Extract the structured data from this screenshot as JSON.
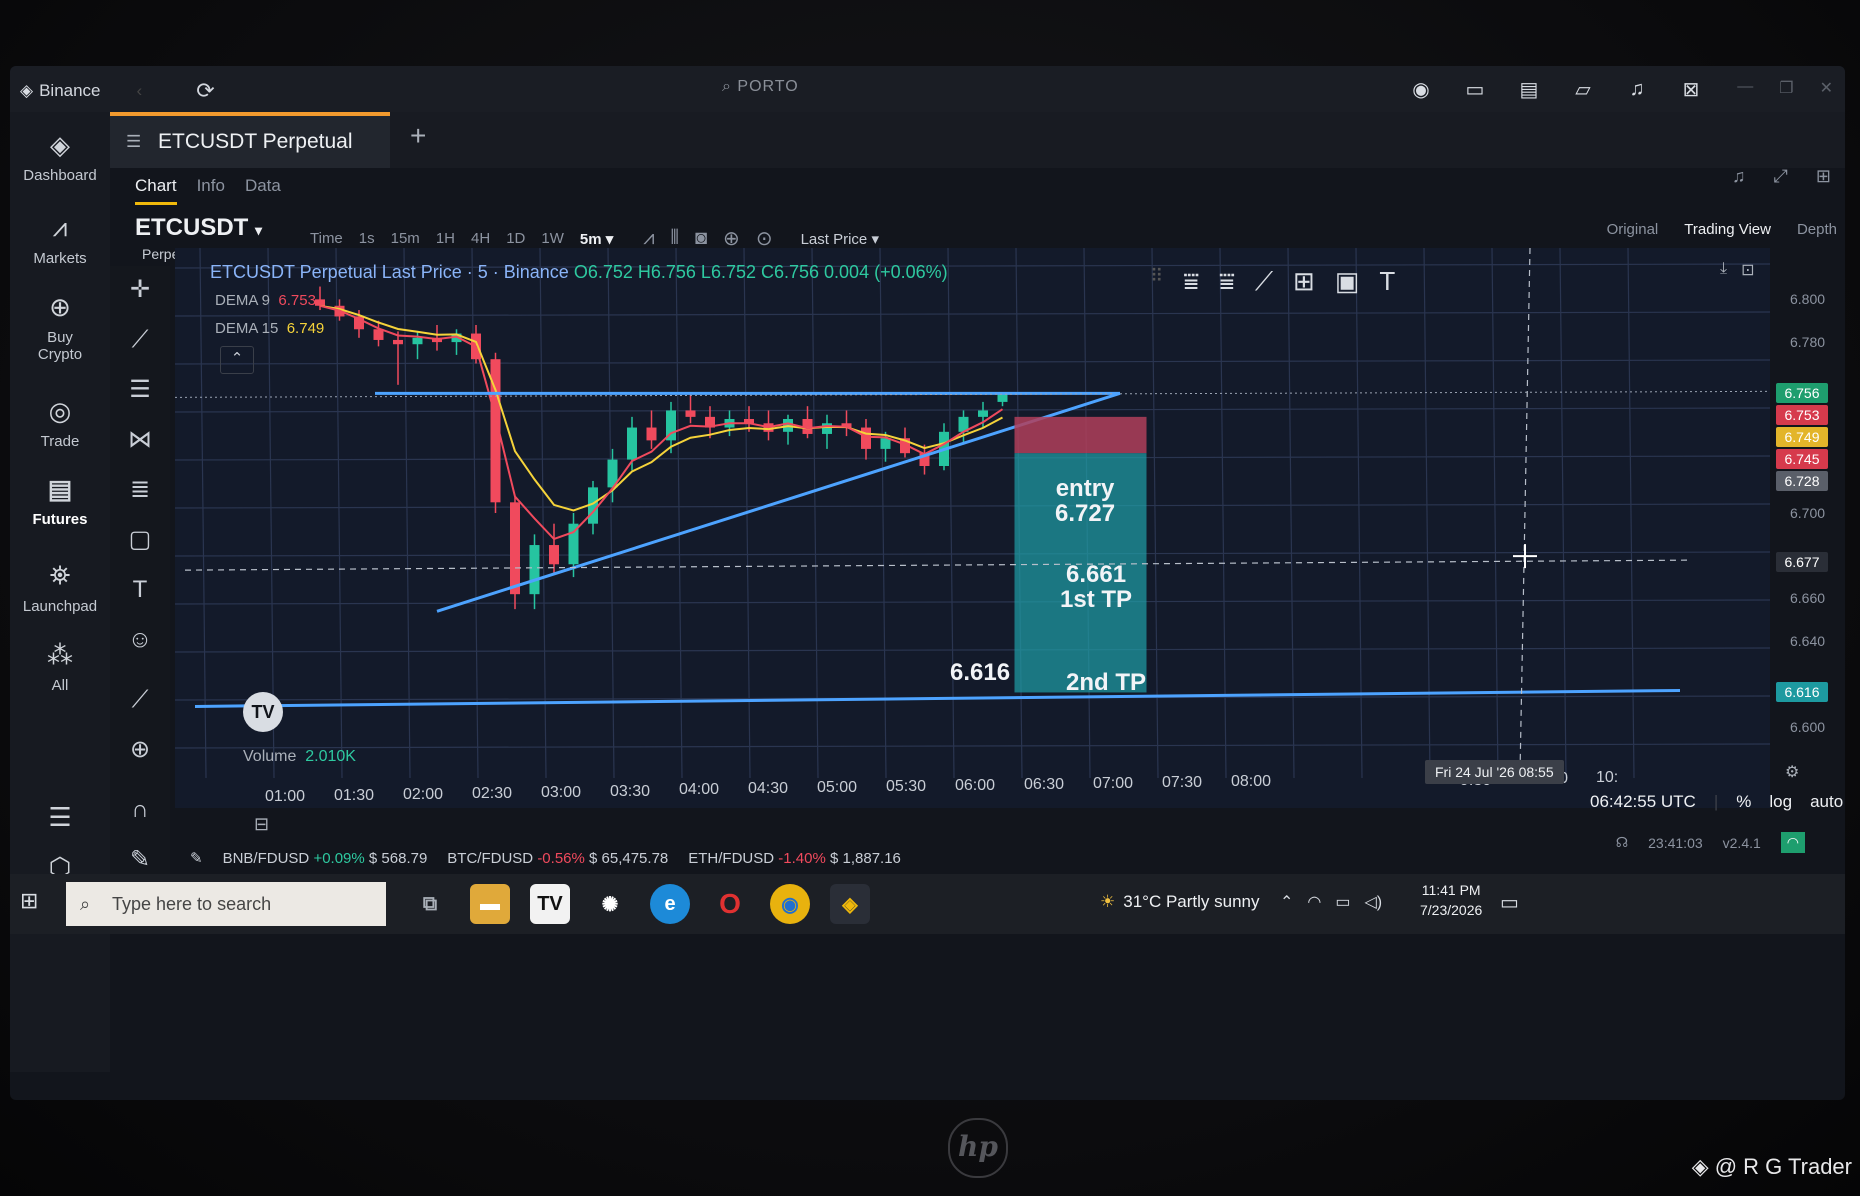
{
  "app": {
    "name": "Binance",
    "search_text": "PORTO"
  },
  "nav": [
    {
      "label": "Dashboard",
      "icon": "dashboard-icon"
    },
    {
      "label": "Markets",
      "icon": "markets-icon"
    },
    {
      "label": "Buy Crypto",
      "icon": "buy-crypto-icon"
    },
    {
      "label": "Trade",
      "icon": "trade-icon"
    },
    {
      "label": "Futures",
      "icon": "futures-icon"
    },
    {
      "label": "Launchpad",
      "icon": "launchpad-icon"
    },
    {
      "label": "All",
      "icon": "all-icon"
    }
  ],
  "tab": {
    "label": "ETCUSDT Perpetual"
  },
  "subtabs": [
    "Chart",
    "Info",
    "Data"
  ],
  "symbol": {
    "name": "ETCUSDT",
    "type": "Perpetual"
  },
  "intervals": [
    "Time",
    "1s",
    "15m",
    "1H",
    "4H",
    "1D",
    "1W",
    "5m"
  ],
  "selected_interval": "5m",
  "price_source": "Last Price",
  "view_modes": [
    "Original",
    "Trading View",
    "Depth"
  ],
  "selected_view": "Trading View",
  "legend": {
    "title": "ETCUSDT Perpetual Last Price · 5 · Binance",
    "ohlc": "O6.752  H6.756  L6.752  C6.756  0.004 (+0.06%)"
  },
  "indicators": [
    {
      "label": "DEMA 9",
      "value": "6.753"
    },
    {
      "label": "DEMA 15",
      "value": "6.749"
    }
  ],
  "annotations": {
    "entry_label": "entry",
    "entry_value": "6.727",
    "tp1_value": "6.661",
    "tp1_label": "1st TP",
    "tp2_value": "6.616",
    "tp2_label": "2nd TP"
  },
  "price_axis": [
    "6.800",
    "6.780",
    "6.700",
    "6.660",
    "6.640",
    "6.600"
  ],
  "price_tags": [
    {
      "value": "6.756",
      "color": "#1e9e6e"
    },
    {
      "value": "6.753",
      "color": "#d63a4c"
    },
    {
      "value": "6.749",
      "color": "#e3b52a"
    },
    {
      "value": "6.745",
      "color": "#d63a4c"
    },
    {
      "value": "6.728",
      "color": "#5a5f69"
    },
    {
      "value": "6.677",
      "color": "#2a2e37"
    },
    {
      "value": "6.616",
      "color": "#1d9aa0"
    }
  ],
  "time_axis": [
    "01:00",
    "01:30",
    "02:00",
    "02:30",
    "03:00",
    "03:30",
    "04:00",
    "04:30",
    "05:00",
    "05:30",
    "06:00",
    "06:30",
    "07:00",
    "07:30",
    "08:00",
    "9:30",
    "10:00",
    "10:"
  ],
  "crosshair_date": "Fri 24 Jul '26   08:55",
  "volume": {
    "label": "Volume",
    "value": "2.010K"
  },
  "utc_time": "06:42:55 UTC",
  "scale_opts": [
    "%",
    "log",
    "auto"
  ],
  "tickers": [
    {
      "pair": "BNB/FDUSD",
      "change": "+0.09%",
      "price": "$ 568.79",
      "dir": "up"
    },
    {
      "pair": "BTC/FDUSD",
      "change": "-0.56%",
      "price": "$ 65,475.78",
      "dir": "down"
    },
    {
      "pair": "ETH/FDUSD",
      "change": "-1.40%",
      "price": "$ 1,887.16",
      "dir": "down"
    }
  ],
  "status": {
    "time": "23:41:03",
    "version": "v2.4.1"
  },
  "taskbar": {
    "search_placeholder": "Type here to search",
    "weather": "31°C  Partly sunny",
    "clock_time": "11:41 PM",
    "clock_date": "7/23/2026"
  },
  "watermark": "@ R G Trader",
  "hp_logo": "hp",
  "tv_logo": "TV",
  "chart_data": {
    "type": "candlestick",
    "symbol": "ETCUSDT Perpetual",
    "interval": "5m",
    "ylim": [
      6.59,
      6.81
    ],
    "candles": [
      {
        "t": "00:50",
        "o": 6.8,
        "h": 6.806,
        "l": 6.795,
        "c": 6.797
      },
      {
        "t": "01:00",
        "o": 6.797,
        "h": 6.8,
        "l": 6.79,
        "c": 6.792
      },
      {
        "t": "01:10",
        "o": 6.792,
        "h": 6.795,
        "l": 6.782,
        "c": 6.786
      },
      {
        "t": "01:20",
        "o": 6.786,
        "h": 6.79,
        "l": 6.778,
        "c": 6.781
      },
      {
        "t": "01:30",
        "o": 6.781,
        "h": 6.785,
        "l": 6.76,
        "c": 6.779
      },
      {
        "t": "01:40",
        "o": 6.779,
        "h": 6.785,
        "l": 6.772,
        "c": 6.782
      },
      {
        "t": "01:50",
        "o": 6.782,
        "h": 6.788,
        "l": 6.776,
        "c": 6.78
      },
      {
        "t": "02:00",
        "o": 6.78,
        "h": 6.786,
        "l": 6.774,
        "c": 6.784
      },
      {
        "t": "02:10",
        "o": 6.784,
        "h": 6.788,
        "l": 6.77,
        "c": 6.772
      },
      {
        "t": "02:20",
        "o": 6.772,
        "h": 6.775,
        "l": 6.7,
        "c": 6.705
      },
      {
        "t": "02:30",
        "o": 6.705,
        "h": 6.708,
        "l": 6.655,
        "c": 6.662
      },
      {
        "t": "02:40",
        "o": 6.662,
        "h": 6.69,
        "l": 6.655,
        "c": 6.685
      },
      {
        "t": "02:50",
        "o": 6.685,
        "h": 6.695,
        "l": 6.672,
        "c": 6.676
      },
      {
        "t": "03:00",
        "o": 6.676,
        "h": 6.7,
        "l": 6.67,
        "c": 6.695
      },
      {
        "t": "03:10",
        "o": 6.695,
        "h": 6.715,
        "l": 6.69,
        "c": 6.712
      },
      {
        "t": "03:20",
        "o": 6.712,
        "h": 6.73,
        "l": 6.705,
        "c": 6.725
      },
      {
        "t": "03:30",
        "o": 6.725,
        "h": 6.745,
        "l": 6.72,
        "c": 6.74
      },
      {
        "t": "03:40",
        "o": 6.74,
        "h": 6.748,
        "l": 6.73,
        "c": 6.734
      },
      {
        "t": "03:50",
        "o": 6.734,
        "h": 6.752,
        "l": 6.728,
        "c": 6.748
      },
      {
        "t": "04:00",
        "o": 6.748,
        "h": 6.756,
        "l": 6.742,
        "c": 6.745
      },
      {
        "t": "04:10",
        "o": 6.745,
        "h": 6.75,
        "l": 6.735,
        "c": 6.74
      },
      {
        "t": "04:20",
        "o": 6.74,
        "h": 6.748,
        "l": 6.736,
        "c": 6.744
      },
      {
        "t": "04:30",
        "o": 6.744,
        "h": 6.75,
        "l": 6.738,
        "c": 6.742
      },
      {
        "t": "04:40",
        "o": 6.742,
        "h": 6.748,
        "l": 6.734,
        "c": 6.738
      },
      {
        "t": "04:50",
        "o": 6.738,
        "h": 6.746,
        "l": 6.732,
        "c": 6.744
      },
      {
        "t": "05:00",
        "o": 6.744,
        "h": 6.75,
        "l": 6.735,
        "c": 6.737
      },
      {
        "t": "05:10",
        "o": 6.737,
        "h": 6.746,
        "l": 6.73,
        "c": 6.742
      },
      {
        "t": "05:20",
        "o": 6.742,
        "h": 6.748,
        "l": 6.736,
        "c": 6.74
      },
      {
        "t": "05:30",
        "o": 6.74,
        "h": 6.744,
        "l": 6.725,
        "c": 6.73
      },
      {
        "t": "05:40",
        "o": 6.73,
        "h": 6.738,
        "l": 6.724,
        "c": 6.735
      },
      {
        "t": "05:50",
        "o": 6.735,
        "h": 6.74,
        "l": 6.726,
        "c": 6.728
      },
      {
        "t": "06:00",
        "o": 6.728,
        "h": 6.732,
        "l": 6.718,
        "c": 6.722
      },
      {
        "t": "06:10",
        "o": 6.722,
        "h": 6.742,
        "l": 6.72,
        "c": 6.738
      },
      {
        "t": "06:20",
        "o": 6.738,
        "h": 6.748,
        "l": 6.732,
        "c": 6.745
      },
      {
        "t": "06:30",
        "o": 6.745,
        "h": 6.752,
        "l": 6.74,
        "c": 6.748
      },
      {
        "t": "06:40",
        "o": 6.752,
        "h": 6.756,
        "l": 6.75,
        "c": 6.756
      }
    ],
    "series": [
      {
        "name": "DEMA 9",
        "color": "#f04a5d"
      },
      {
        "name": "DEMA 15",
        "color": "#f5d33a"
      }
    ]
  }
}
